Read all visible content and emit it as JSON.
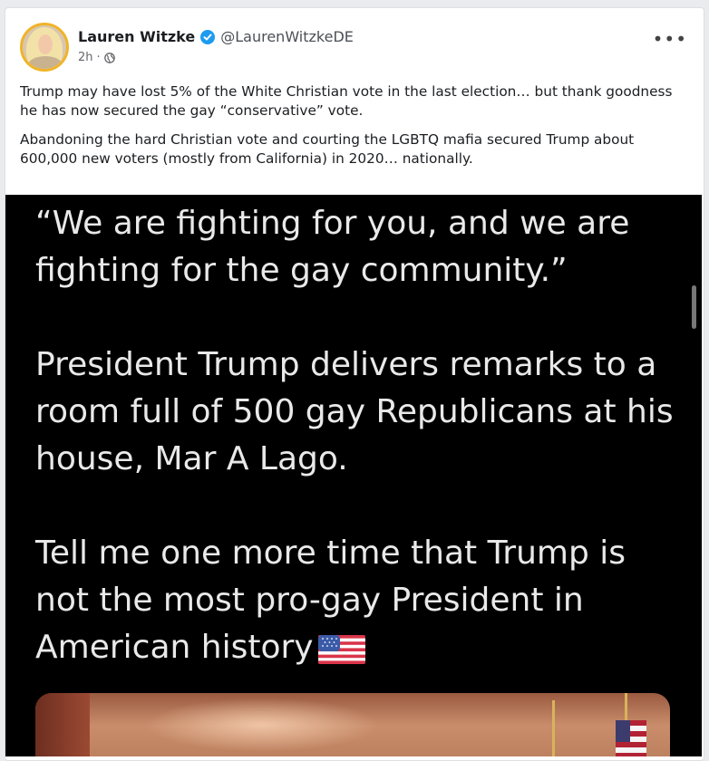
{
  "post": {
    "author_name": "Lauren Witzke",
    "handle": "@LaurenWitzkeDE",
    "time": "2h",
    "separator": "·",
    "more_label": "•••",
    "paragraphs": [
      "Trump may have lost 5% of the White Christian vote in the last election… but thank goodness he has now secured the gay “conservative” vote.",
      "Abandoning the hard Christian vote and courting the LGBTQ mafia secured Trump about 600,000 new voters (mostly from California) in 2020… nationally."
    ]
  },
  "media": {
    "quote": "“We are fighting for you, and we are fighting for the gay community.”",
    "line2": "President Trump delivers remarks to a room full of 500 gay Republicans at his house, Mar A Lago.",
    "line3": "Tell me one more time that Trump is not the most pro-gay President in American history"
  },
  "icons": {
    "verified": "verified-badge-icon",
    "audience": "globe-icon",
    "flag": "us-flag-icon"
  },
  "colors": {
    "verified_blue": "#1d9bf0",
    "media_bg": "#000000",
    "avatar_ring": "#f0b429"
  }
}
